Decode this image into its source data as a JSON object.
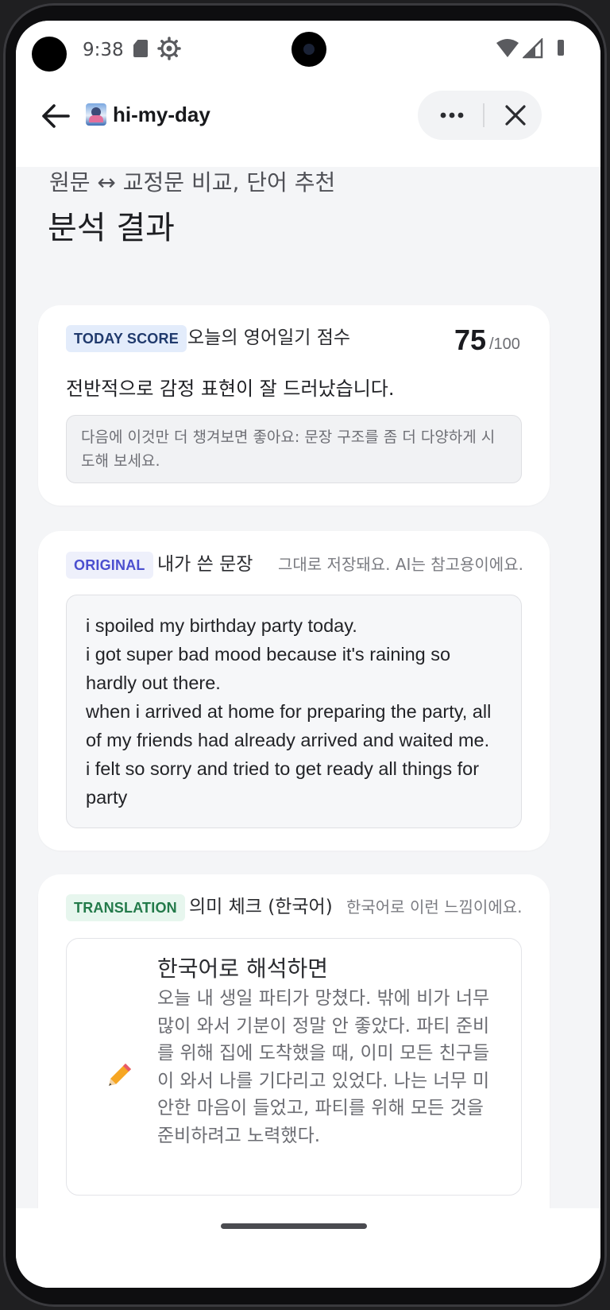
{
  "status_bar": {
    "time": "9:38",
    "icons": [
      "sd-card-icon",
      "gear-icon",
      "wifi-icon",
      "signal-icon",
      "battery-icon"
    ]
  },
  "appbar": {
    "title": "hi-my-day",
    "icons": [
      "back-arrow-icon",
      "app-logo",
      "more-dots-icon",
      "close-icon"
    ]
  },
  "page": {
    "subtitle": "원문 ↔ 교정문 비교, 단어 추천",
    "title": "분석 결과"
  },
  "score_card": {
    "chip": "TODAY SCORE",
    "label": "오늘의 영어일기 점수",
    "score": "75",
    "max": "/100",
    "summary": "전반적으로 감정 표현이 잘 드러났습니다.",
    "tip": "다음에 이것만 더 챙겨보면 좋아요: 문장 구조를 좀 더 다양하게 시도해 보세요."
  },
  "original_card": {
    "chip": "ORIGINAL",
    "label": "내가 쓴 문장",
    "hint": "그대로 저장돼요. AI는 참고용이에요.",
    "text": "i spoiled my birthday party today.\ni got super bad mood because it's raining so hardly out there.\nwhen i arrived at home for preparing the party, all of my friends had already arrived and waited me.\ni felt so sorry and tried to get ready all things for party"
  },
  "translation_card": {
    "chip": "TRANSLATION",
    "label": "의미 체크 (한국어)",
    "hint": "한국어로 이런 느낌이에요.",
    "heading": "한국어로 해석하면",
    "icon": "pencil-icon",
    "body": "오늘 내 생일 파티가 망쳤다. 밖에 비가 너무 많이 와서 기분이 정말 안 좋았다. 파티 준비를 위해 집에 도착했을 때, 이미 모든 친구들이 와서 나를 기다리고 있었다. 나는 너무 미안한 마음이 들었고, 파티를 위해 모든 것을 준비하려고 노력했다."
  },
  "colors": {
    "accent_score": "#203a6d",
    "accent_original": "#4b4fcf",
    "accent_translation": "#237a4a",
    "background": "#f4f5f7"
  }
}
